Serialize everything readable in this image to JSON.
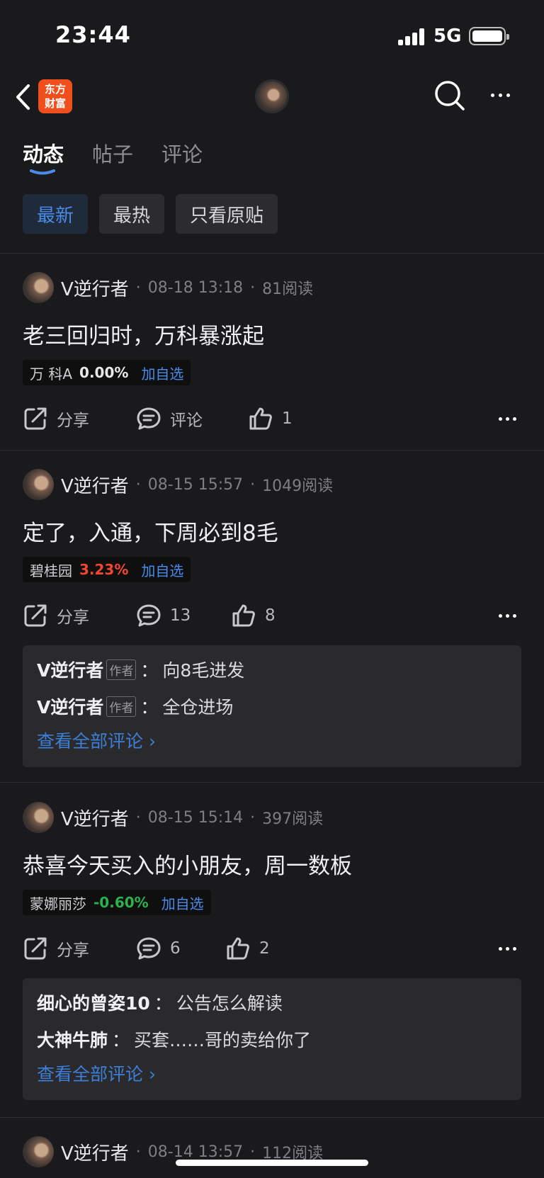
{
  "status_bar": {
    "time": "23:44",
    "network": "5G"
  },
  "nav": {
    "logo_line1": "东方",
    "logo_line2": "财富"
  },
  "tabs": [
    {
      "label": "动态"
    },
    {
      "label": "帖子"
    },
    {
      "label": "评论"
    }
  ],
  "filters": [
    {
      "label": "最新"
    },
    {
      "label": "最热"
    },
    {
      "label": "只看原贴"
    }
  ],
  "colors": {
    "accent": "#4a8bea",
    "up": "#f2472e",
    "down": "#2bb24c",
    "brand": "#f04e1c"
  },
  "posts": [
    {
      "author": "V逆行者",
      "time": "08-18 13:18",
      "reads": "81阅读",
      "title": "老三回归时，万科暴涨起",
      "stock": {
        "name": "万 科A",
        "pct": "0.00%",
        "add": "加自选",
        "color": "#e8e8ea"
      },
      "share": "分享",
      "comment": "评论",
      "likes": "1"
    },
    {
      "author": "V逆行者",
      "time": "08-15 15:57",
      "reads": "1049阅读",
      "title": "定了，入通，下周必到8毛",
      "stock": {
        "name": "碧桂园",
        "pct": "3.23%",
        "add": "加自选",
        "color": "#f2472e"
      },
      "share": "分享",
      "comment": "13",
      "likes": "8",
      "comments": [
        {
          "user": "V逆行者",
          "badge": "作者",
          "text": "向8毛进发"
        },
        {
          "user": "V逆行者",
          "badge": "作者",
          "text": "全仓进场"
        }
      ],
      "view_all": "查看全部评论 ›"
    },
    {
      "author": "V逆行者",
      "time": "08-15 15:14",
      "reads": "397阅读",
      "title": "恭喜今天买入的小朋友，周一数板",
      "stock": {
        "name": "蒙娜丽莎",
        "pct": "-0.60%",
        "add": "加自选",
        "color": "#2bb24c"
      },
      "share": "分享",
      "comment": "6",
      "likes": "2",
      "comments": [
        {
          "user": "细心的曾姿10",
          "text": "公告怎么解读"
        },
        {
          "user": "大神牛肺",
          "text": "买套……哥的卖给你了"
        }
      ],
      "view_all": "查看全部评论 ›"
    },
    {
      "author": "V逆行者",
      "time": "08-14 13:57",
      "reads": "112阅读"
    }
  ]
}
